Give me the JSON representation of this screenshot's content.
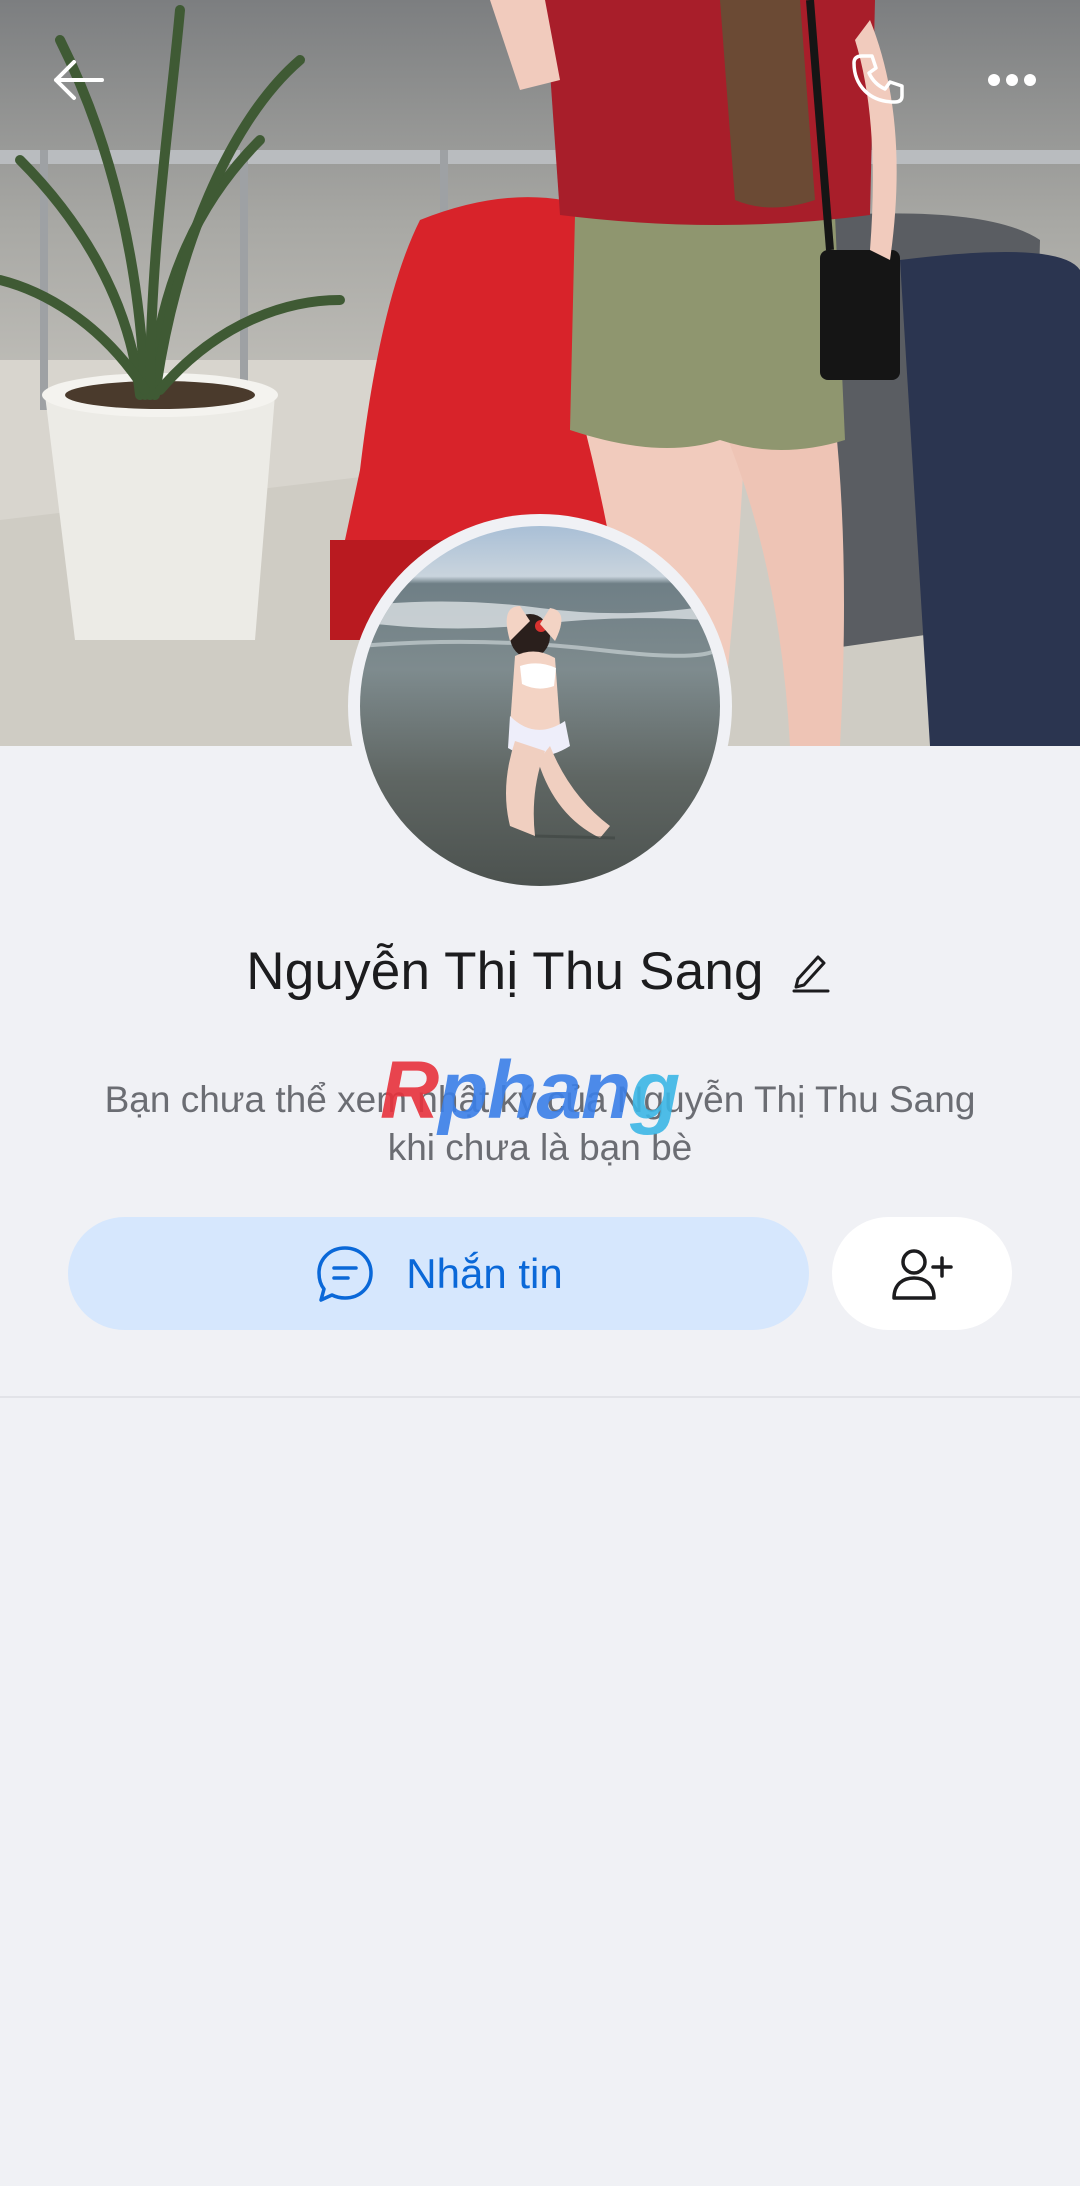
{
  "profile": {
    "name": "Nguyễn Thị Thu Sang",
    "notice_line1": "Bạn chưa thể xem nhật ký của Nguyễn Thị Thu Sang",
    "notice_line2": "khi chưa là bạn bè"
  },
  "watermark": {
    "part1": "R",
    "part2": "phan",
    "part3": "g"
  },
  "actions": {
    "message_label": "Nhắn tin"
  },
  "icons": {
    "back": "arrow-left-icon",
    "call": "phone-icon",
    "more": "more-dots-icon",
    "edit": "pencil-icon",
    "message": "chat-bubble-icon",
    "add_friend": "add-user-icon"
  },
  "colors": {
    "accent": "#0a68d8",
    "accent_bg": "#d6e7fd",
    "background": "#f0f1f5"
  }
}
